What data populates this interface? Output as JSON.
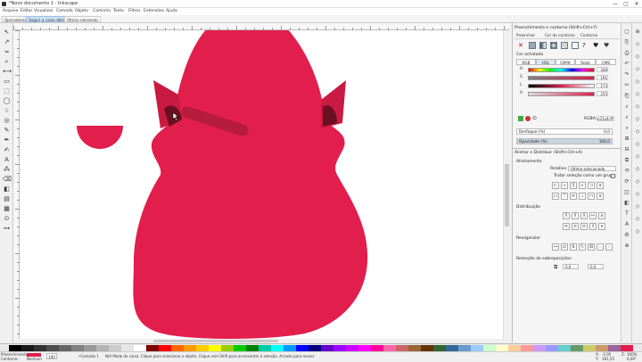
{
  "window": {
    "title": "*Novo documento 1 - Inkscape",
    "controls": [
      "—",
      "▢",
      "✕"
    ]
  },
  "menu": [
    "Arquivo",
    "Editar",
    "Visualizar",
    "Camada",
    "Objeto",
    "Caminho",
    "Texto",
    "Filtros",
    "Extensões",
    "Ajuda"
  ],
  "tabs": [
    "Operadores",
    "Seguir a caixa delimit.",
    "Último elemento"
  ],
  "tools": [
    {
      "name": "selector-tool",
      "glyph": "↖"
    },
    {
      "name": "node-tool",
      "glyph": "↗"
    },
    {
      "name": "tweak-tool",
      "glyph": "≈"
    },
    {
      "name": "zoom-tool",
      "glyph": "⌕"
    },
    {
      "name": "measure-tool",
      "glyph": "⟷"
    },
    {
      "name": "rect-tool",
      "glyph": "▭"
    },
    {
      "name": "box3d-tool",
      "glyph": "⬚"
    },
    {
      "name": "ellipse-tool",
      "glyph": "◯"
    },
    {
      "name": "star-tool",
      "glyph": "☆"
    },
    {
      "name": "spiral-tool",
      "glyph": "◎"
    },
    {
      "name": "pencil-tool",
      "glyph": "✎"
    },
    {
      "name": "pen-tool",
      "glyph": "✒"
    },
    {
      "name": "calligraphy-tool",
      "glyph": "✍"
    },
    {
      "name": "text-tool",
      "glyph": "A"
    },
    {
      "name": "spray-tool",
      "glyph": "⁂"
    },
    {
      "name": "eraser-tool",
      "glyph": "⌫"
    },
    {
      "name": "bucket-tool",
      "glyph": "◧"
    },
    {
      "name": "gradient-tool",
      "glyph": "▤"
    },
    {
      "name": "mesh-tool",
      "glyph": "▦"
    },
    {
      "name": "dropper-tool",
      "glyph": "⊙"
    },
    {
      "name": "connector-tool",
      "glyph": "⊶"
    }
  ],
  "fill_stroke": {
    "title": "Preenchimento e contorno (Shift+Ctrl+F)",
    "tabs": [
      "Preencher",
      "Cor do contorno",
      "Contorno"
    ],
    "flat_color_label": "Cor achatada",
    "modes": [
      "RGB",
      "HSL",
      "CMYK",
      "Roda",
      "CMS"
    ],
    "active_mode": "HSL",
    "channels": [
      {
        "label": "H",
        "value": "349"
      },
      {
        "label": "S",
        "value": "191"
      },
      {
        "label": "L",
        "value": "173"
      },
      {
        "label": "A",
        "value": "255"
      }
    ],
    "rgba_label": "RGBA:",
    "rgba_value": "e21e4cff",
    "blur_label": "Desfoque (%)",
    "blur_value": "0,0",
    "opacity_label": "Opacidade (%)",
    "opacity_value": "100,0",
    "accent_color": "#e21e4c"
  },
  "align": {
    "title": "Alinhar e Distribuir (Shift+Ctrl+A)",
    "section_align": "Alinhamento",
    "relative_label": "Relativo a:",
    "relative_value": "Último selecionado",
    "group_label": "Tratar seleção como um grupo:",
    "section_distribute": "Distribuição",
    "section_rearrange": "Reorganizar",
    "section_overlap": "Remoção de sobreposições:",
    "h_gap": "0,0",
    "v_gap": "0,0"
  },
  "palette_colors": [
    "#000000",
    "#1a1a1a",
    "#333333",
    "#4d4d4d",
    "#666666",
    "#808080",
    "#999999",
    "#b3b3b3",
    "#cccccc",
    "#e6e6e6",
    "#ffffff",
    "#800000",
    "#ff0000",
    "#ff6600",
    "#ff9900",
    "#ffcc00",
    "#ffff00",
    "#99cc00",
    "#00cc00",
    "#008000",
    "#00ccaa",
    "#00ffff",
    "#0099ff",
    "#0000ff",
    "#000080",
    "#6600cc",
    "#9900ff",
    "#cc00ff",
    "#ff00ff",
    "#ff0099",
    "#ff66aa",
    "#cc6666",
    "#996633",
    "#663300",
    "#336633",
    "#336699",
    "#6699cc",
    "#99ccff",
    "#ccffcc",
    "#ffffcc",
    "#ffcc99",
    "#ff9999",
    "#cc99ff",
    "#9999ff",
    "#66cccc",
    "#669966",
    "#cccc66",
    "#cc9966",
    "#996699",
    "#e21e4c"
  ],
  "status": {
    "fill_label": "Preenchimento:",
    "stroke_label": "Contorno:",
    "stroke_value": "Nenhum",
    "opacity": "100",
    "layer": "•Camada 1",
    "message": "N/A Modo de caixa. Clique para selecionar o objeto. Clique com Shift para acrescentar à seleção. Arraste para mover.",
    "x_label": "X:",
    "x_value": "-2,95",
    "y_label": "Y:",
    "y_value": "181,55",
    "z_label": "Z:",
    "zoom": "100%",
    "rotation": "0,00°"
  },
  "canvas_colors": {
    "body": "#e21e4c",
    "ear_inner": "#6b1020",
    "stripe": "#b81c3c"
  }
}
